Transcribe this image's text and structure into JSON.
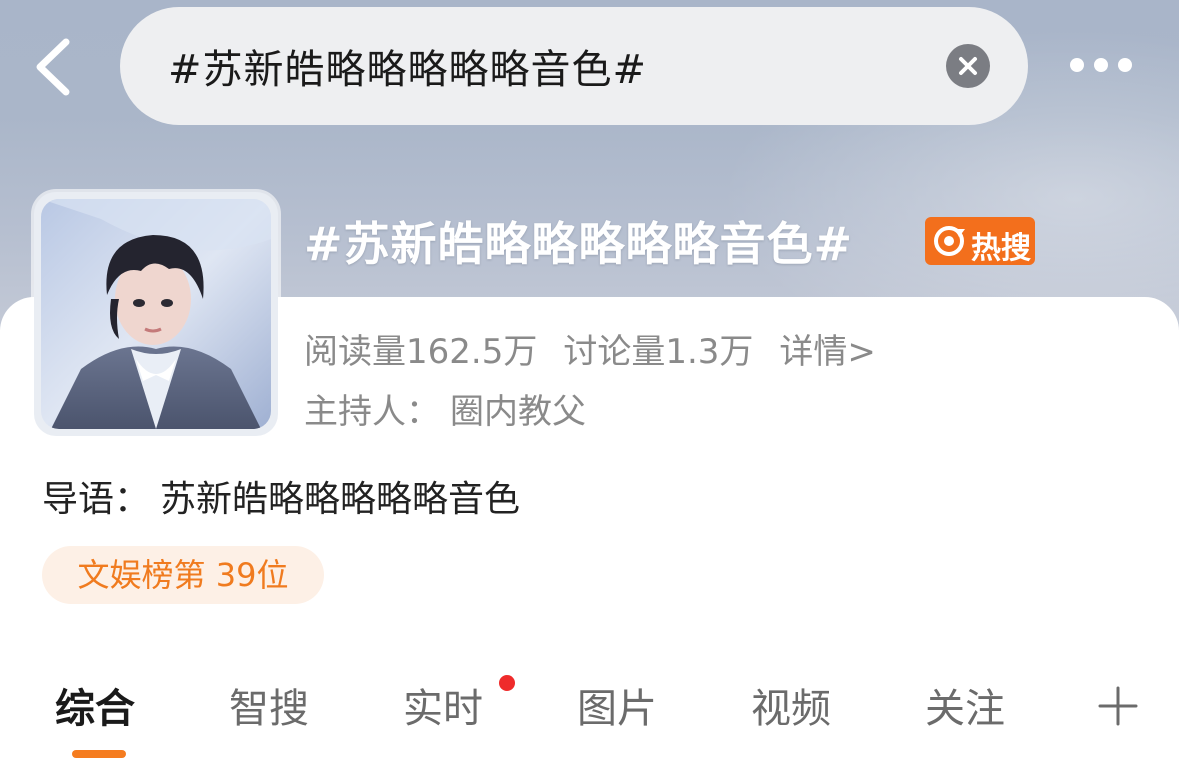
{
  "search": {
    "query": "#苏新皓略略略略略音色#"
  },
  "topic": {
    "title": "#苏新皓略略略略略音色#",
    "hot_badge": "热搜",
    "reads": "阅读量162.5万",
    "discussions": "讨论量1.3万",
    "details": "详情>",
    "host_label": "主持人：",
    "host_name": "圈内教父",
    "lead_label": "导语：",
    "lead_text": "苏新皓略略略略略音色",
    "rank": "文娱榜第 39位"
  },
  "tabs": [
    {
      "label": "综合",
      "active": true
    },
    {
      "label": "智搜",
      "active": false
    },
    {
      "label": "实时",
      "active": false,
      "dot": true
    },
    {
      "label": "图片",
      "active": false
    },
    {
      "label": "视频",
      "active": false
    },
    {
      "label": "关注",
      "active": false
    }
  ],
  "icons": {
    "back": "chevron-left-icon",
    "clear": "close-circle-icon",
    "more": "more-dots-icon",
    "add": "plus-icon",
    "hot": "flame-icon"
  },
  "colors": {
    "accent": "#f57c1f",
    "hot_badge": "#f36f1c",
    "red_dot": "#ef2b2b",
    "rank_bg": "#fdf0e6"
  }
}
